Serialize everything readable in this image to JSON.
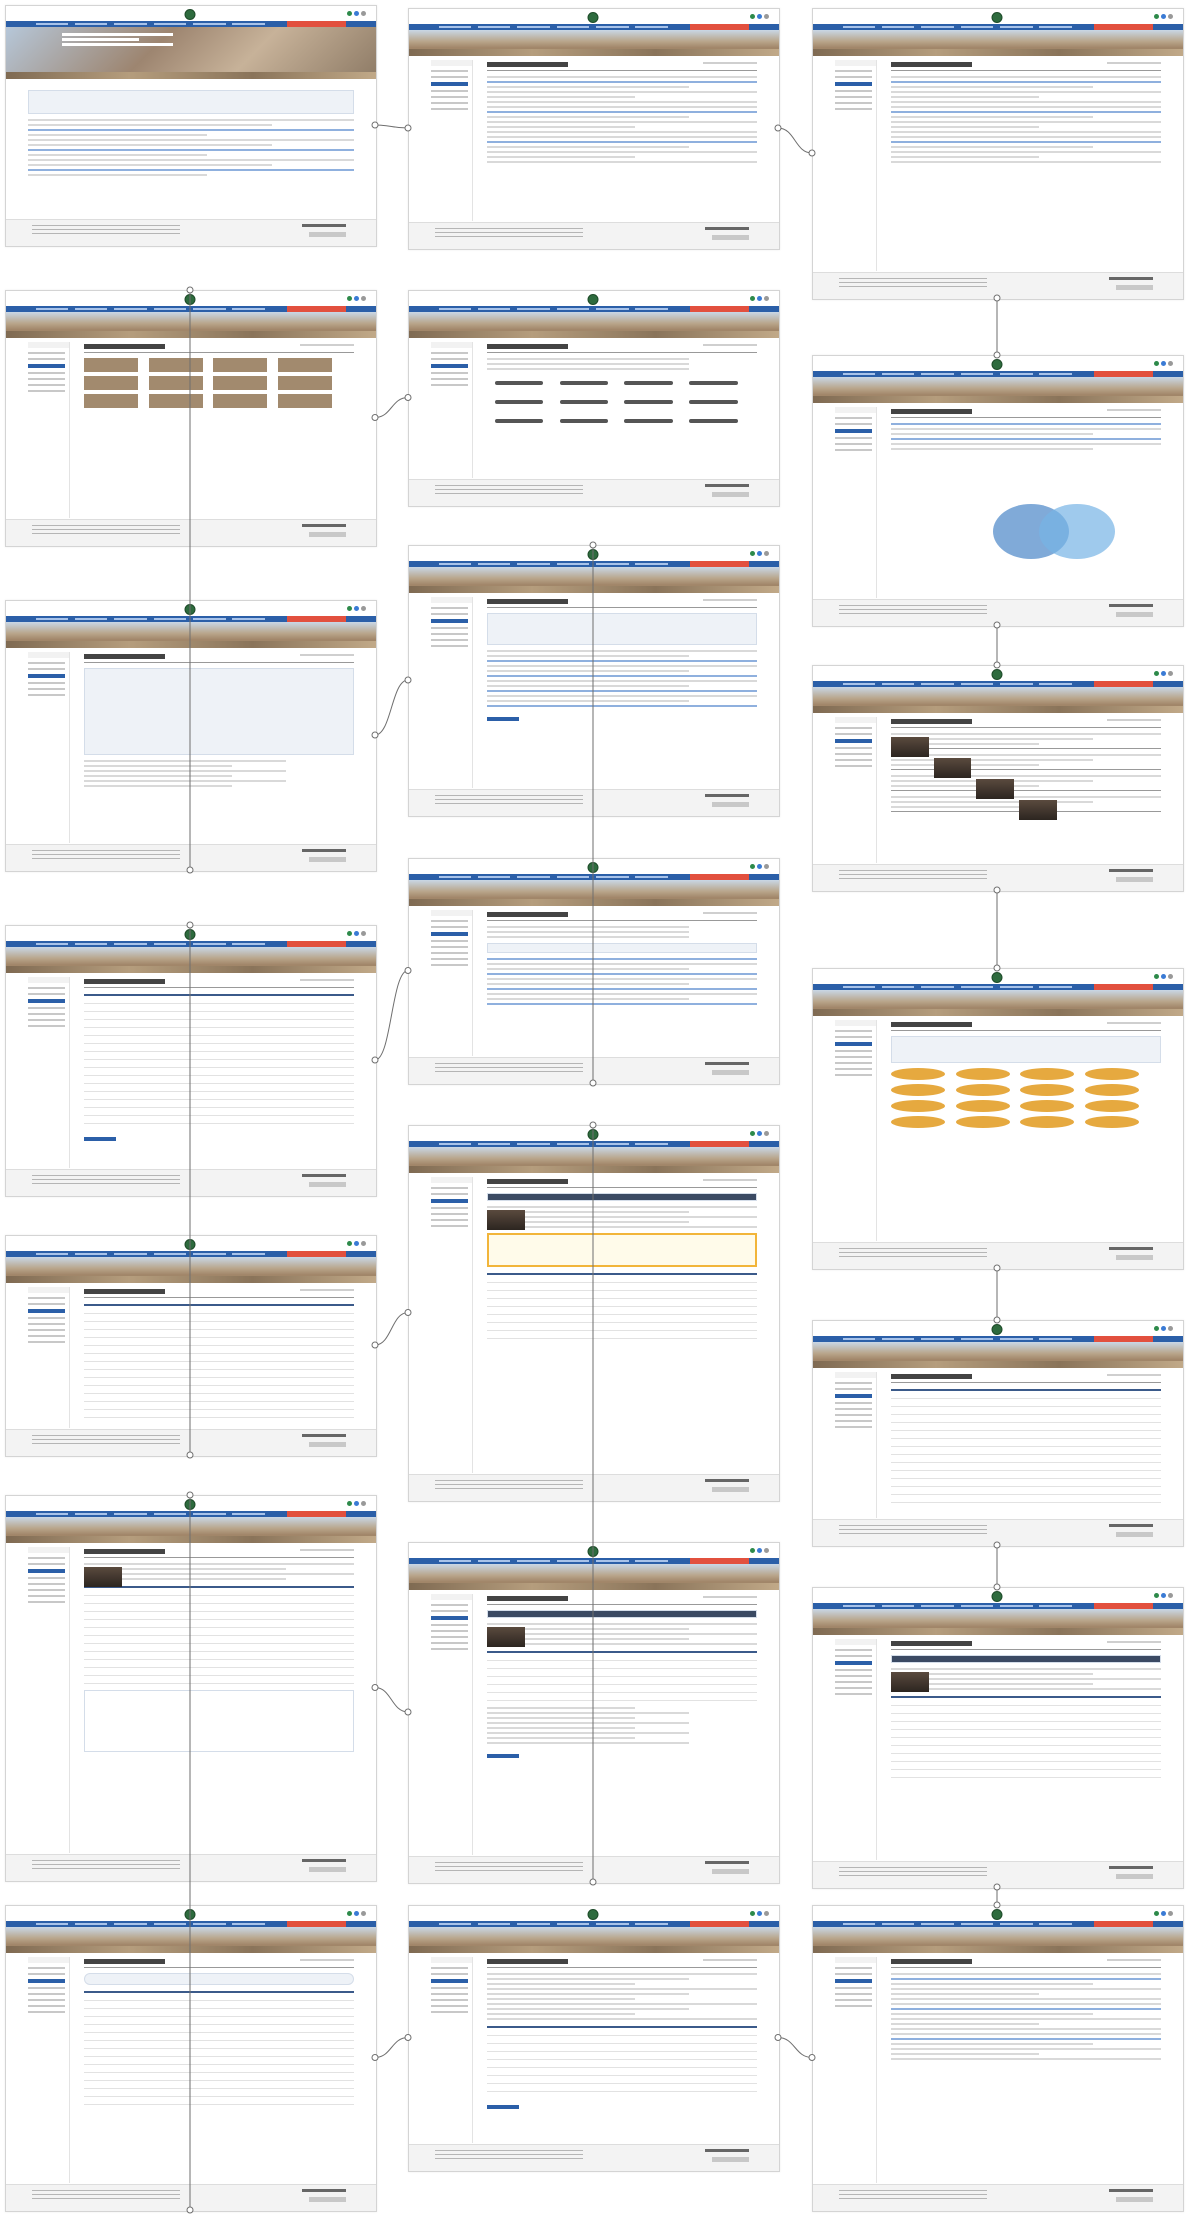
{
  "diagram": {
    "type": "sitemap-flow",
    "screens": [
      {
        "id": "s01",
        "template": "home",
        "col": 0,
        "row": 0
      },
      {
        "id": "s02",
        "template": "text",
        "col": 1,
        "row": 0
      },
      {
        "id": "s03",
        "template": "text",
        "col": 2,
        "row": 0
      },
      {
        "id": "s04",
        "template": "gallery",
        "col": 0,
        "row": 1
      },
      {
        "id": "s05",
        "template": "org",
        "col": 1,
        "row": 1
      },
      {
        "id": "s06",
        "template": "vision",
        "col": 2,
        "row": 1
      },
      {
        "id": "s07",
        "template": "map",
        "col": 0,
        "row": 2
      },
      {
        "id": "s08",
        "template": "program",
        "col": 1,
        "row": 2
      },
      {
        "id": "s09",
        "template": "list",
        "col": 2,
        "row": 2
      },
      {
        "id": "s10",
        "template": "form",
        "col": 0,
        "row": 3
      },
      {
        "id": "s11",
        "template": "check",
        "col": 1,
        "row": 3
      },
      {
        "id": "s12",
        "template": "icons",
        "col": 2,
        "row": 3
      },
      {
        "id": "s13",
        "template": "table",
        "col": 0,
        "row": 4
      },
      {
        "id": "s14",
        "template": "profile",
        "col": 1,
        "row": 4
      },
      {
        "id": "s15",
        "template": "table",
        "col": 2,
        "row": 4
      },
      {
        "id": "s16",
        "template": "calendar",
        "col": 0,
        "row": 5
      },
      {
        "id": "s17",
        "template": "profile2",
        "col": 1,
        "row": 5
      },
      {
        "id": "s18",
        "template": "profile3",
        "col": 2,
        "row": 5
      },
      {
        "id": "s19",
        "template": "steps",
        "col": 0,
        "row": 6
      },
      {
        "id": "s20",
        "template": "board",
        "col": 1,
        "row": 6
      },
      {
        "id": "s21",
        "template": "text",
        "col": 2,
        "row": 6
      }
    ],
    "flow": [
      "s01",
      "s02",
      "s03",
      "s06",
      "s09",
      "s12",
      "s15",
      "s18",
      "s21",
      "s20",
      "s19",
      "s16",
      "s17",
      "s14",
      "s13",
      "s10",
      "s11",
      "s08",
      "s07",
      "s04",
      "s05"
    ]
  }
}
